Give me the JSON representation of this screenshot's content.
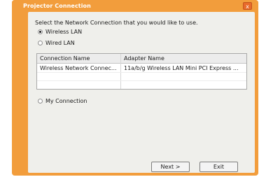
{
  "window": {
    "title": "Projector Connection",
    "close_label": "x"
  },
  "prompt": "Select the Network Connection that you would like to use.",
  "options": {
    "wireless": "Wireless LAN",
    "wired": "Wired LAN",
    "my_connection": "My Connection"
  },
  "selected_option": "wireless",
  "table": {
    "headers": [
      "Connection Name",
      "Adapter Name"
    ],
    "rows": [
      [
        "Wireless Network Connec...",
        "11a/b/g Wireless LAN Mini PCI Express ..."
      ]
    ]
  },
  "buttons": {
    "next": "Next >",
    "exit": "Exit"
  },
  "colors": {
    "title_bar": "#f29d3c",
    "panel": "#efefeb"
  }
}
